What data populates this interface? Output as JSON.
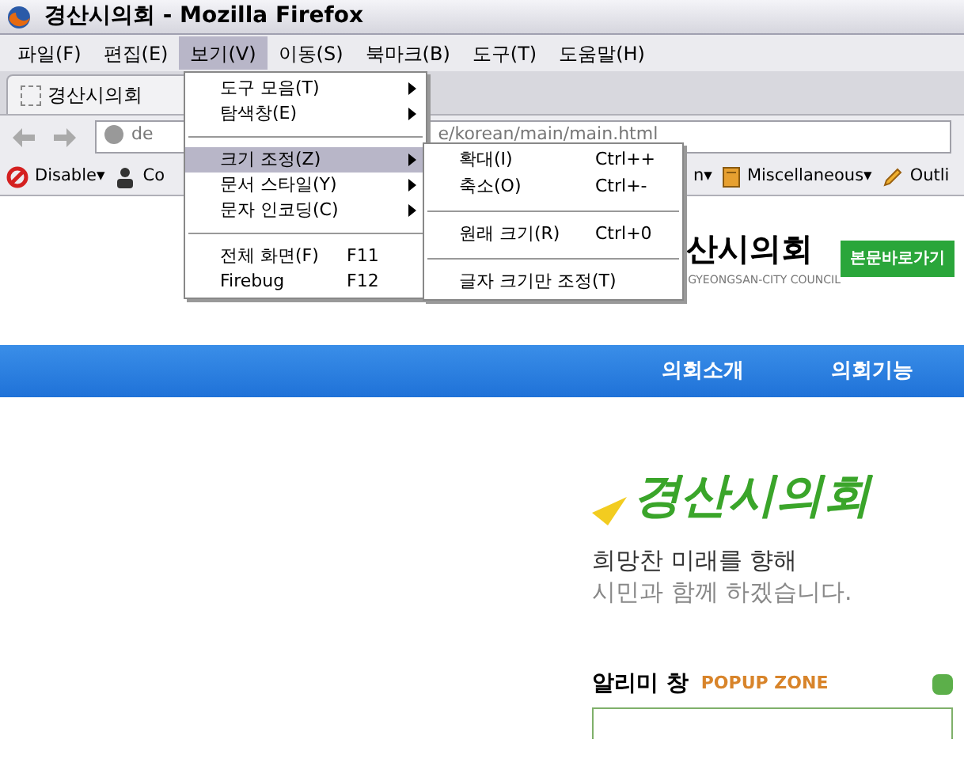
{
  "window": {
    "title": "경산시의회 - Mozilla Firefox"
  },
  "menubar": [
    {
      "label": "파일(F)",
      "selected": false
    },
    {
      "label": "편집(E)",
      "selected": false
    },
    {
      "label": "보기(V)",
      "selected": true
    },
    {
      "label": "이동(S)",
      "selected": false
    },
    {
      "label": "북마크(B)",
      "selected": false
    },
    {
      "label": "도구(T)",
      "selected": false
    },
    {
      "label": "도움말(H)",
      "selected": false
    }
  ],
  "tab": {
    "title": "경산시의회"
  },
  "nav_buttons": [
    {
      "kind": "back"
    },
    {
      "kind": "forward"
    }
  ],
  "address": {
    "start": "de",
    "end": "e/korean/main/main.html"
  },
  "bookmarks": [
    {
      "kind": "blocked",
      "label": "Disable▾"
    },
    {
      "kind": "person",
      "label": "Co"
    },
    {
      "kind": "plain",
      "label": "n▾"
    },
    {
      "kind": "book",
      "label": "Miscellaneous▾"
    },
    {
      "kind": "pencil",
      "label": "Outli"
    }
  ],
  "view_menu": [
    {
      "kind": "item",
      "label": "도구 모음(T)",
      "submenu": true,
      "selected": false
    },
    {
      "kind": "item",
      "label": "탐색창(E)",
      "submenu": true,
      "selected": false
    },
    {
      "kind": "separator"
    },
    {
      "kind": "item",
      "label": "크기 조정(Z)",
      "submenu": true,
      "selected": true
    },
    {
      "kind": "item",
      "label": "문서 스타일(Y)",
      "submenu": true,
      "selected": false
    },
    {
      "kind": "item",
      "label": "문자 인코딩(C)",
      "submenu": true,
      "selected": false
    },
    {
      "kind": "separator"
    },
    {
      "kind": "item",
      "label": "전체 화면(F)",
      "shortcut": "F11",
      "submenu": false,
      "selected": false
    },
    {
      "kind": "item",
      "label": "Firebug",
      "shortcut": "F12",
      "submenu": false,
      "selected": false
    }
  ],
  "zoom_menu": [
    {
      "kind": "item",
      "label": "확대(I)",
      "shortcut": "Ctrl++"
    },
    {
      "kind": "item",
      "label": "축소(O)",
      "shortcut": "Ctrl+-"
    },
    {
      "kind": "separator"
    },
    {
      "kind": "item",
      "label": "원래 크기(R)",
      "shortcut": "Ctrl+0"
    },
    {
      "kind": "separator"
    },
    {
      "kind": "item",
      "label": "글자 크기만 조정(T)"
    }
  ],
  "site": {
    "logo_text": "산시의회",
    "logo_sub": "GYEONGSAN-CITY COUNCIL",
    "skip_link": "본문바로가기",
    "nav": [
      "의회소개",
      "의회기능"
    ],
    "slogan_logo": "경산시의회",
    "slogan": [
      "희망찬 미래를 향해",
      "시민과 함께 하겠습니다."
    ],
    "popup": {
      "title": "알리미 창",
      "subtitle": "POPUP ZONE"
    }
  }
}
